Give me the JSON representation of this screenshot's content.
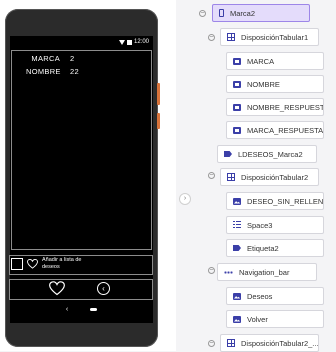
{
  "phone": {
    "status_time": "12:00",
    "rows": [
      {
        "label": "MARCA",
        "value": "2"
      },
      {
        "label": "NOMBRE",
        "value": "22"
      }
    ],
    "wish_text": "Añadir a lista de deseos"
  },
  "tree": {
    "nodes": [
      {
        "id": "marca2",
        "label": "Marca2",
        "icon": "phone-icon"
      },
      {
        "id": "disp1",
        "label": "DisposiciónTabular1",
        "icon": "table-icon"
      },
      {
        "id": "marca",
        "label": "MARCA",
        "icon": "label-icon"
      },
      {
        "id": "nombre",
        "label": "NOMBRE",
        "icon": "label-icon"
      },
      {
        "id": "nombre-resp",
        "label": "NOMBRE_RESPUESTA",
        "icon": "label-icon"
      },
      {
        "id": "marca-resp",
        "label": "MARCA_RESPUESTA",
        "icon": "label-icon"
      },
      {
        "id": "ldeseos",
        "label": "LDESEOS_Marca2",
        "icon": "tag-icon"
      },
      {
        "id": "disp2",
        "label": "DisposiciónTabular2",
        "icon": "table-icon"
      },
      {
        "id": "deseo",
        "label": "DESEO_SIN_RELLEN...",
        "icon": "image-icon"
      },
      {
        "id": "space3",
        "label": "Space3",
        "icon": "space-icon"
      },
      {
        "id": "etiqueta2",
        "label": "Etiqueta2",
        "icon": "tag-icon"
      },
      {
        "id": "navbar",
        "label": "Navigation_bar",
        "icon": "dots-icon"
      },
      {
        "id": "deseos",
        "label": "Deseos",
        "icon": "image-icon"
      },
      {
        "id": "volver",
        "label": "Volver",
        "icon": "image-icon"
      },
      {
        "id": "disp2b",
        "label": "DisposiciónTabular2_...",
        "icon": "table-icon"
      }
    ]
  },
  "colors": {
    "accent": "#3b3fa8",
    "selected_bg": "#e4dcfb",
    "selected_border": "#9d86e8"
  }
}
